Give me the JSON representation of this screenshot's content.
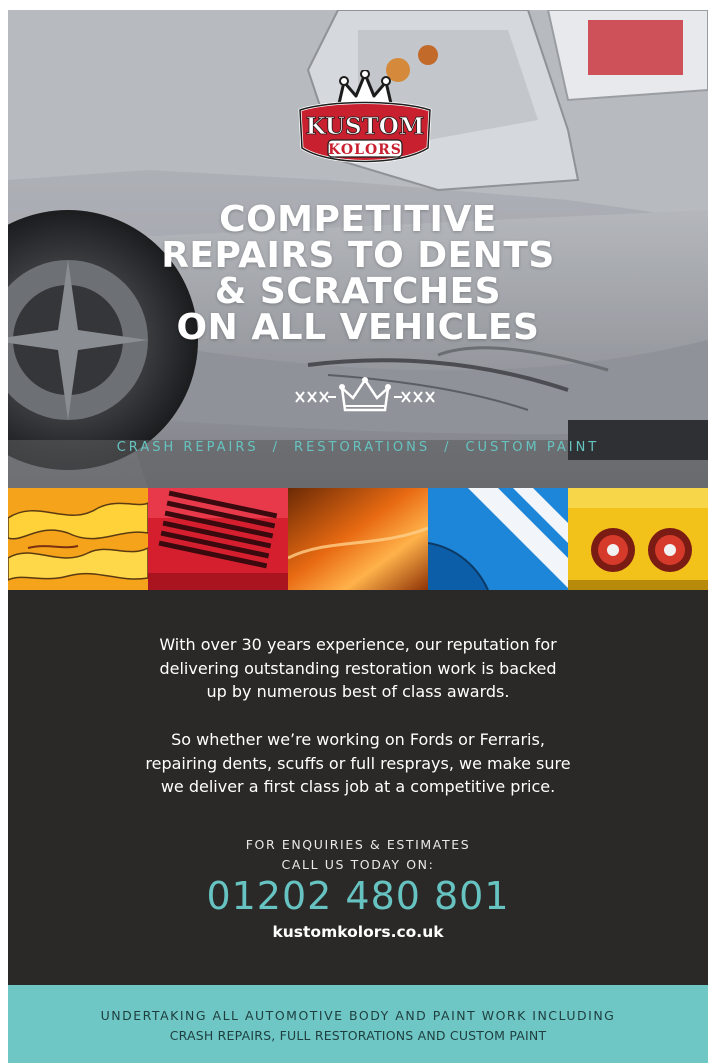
{
  "logo": {
    "line1": "KUSTOM",
    "line2": "KOLORS"
  },
  "headline": [
    "COMPETITIVE",
    "REPAIRS TO DENTS",
    "& SCRATCHES",
    "ON ALL VEHICLES"
  ],
  "services": [
    "CRASH REPAIRS",
    "RESTORATIONS",
    "CUSTOM PAINT"
  ],
  "services_separator": "/",
  "thumbnails": [
    "flame-paint",
    "red-vents",
    "orange-gloss",
    "blue-stripes",
    "yellow-taillights"
  ],
  "intro": {
    "paragraph1": [
      "With over 30 years experience, our reputation for",
      "delivering outstanding restoration work is backed",
      "up by numerous best of class awards."
    ],
    "paragraph2": [
      "So whether we’re working on Fords or Ferraris,",
      "repairing dents, scuffs or full resprays, we make sure",
      "we deliver a first class job at a competitive price."
    ]
  },
  "contact": {
    "line1": "FOR ENQUIRIES & ESTIMATES",
    "line2": "CALL US TODAY ON:",
    "phone": "01202 480 801",
    "website": "kustomkolors.co.uk"
  },
  "footer": {
    "line1": "UNDERTAKING ALL AUTOMOTIVE BODY AND PAINT WORK INCLUDING",
    "line2": "CRASH REPAIRS, FULL RESTORATIONS AND CUSTOM PAINT"
  },
  "colors": {
    "accent": "#66c3c1",
    "dark": "#2a2927",
    "footer_bg": "#6ec7c4",
    "logo_red": "#c8202f"
  }
}
